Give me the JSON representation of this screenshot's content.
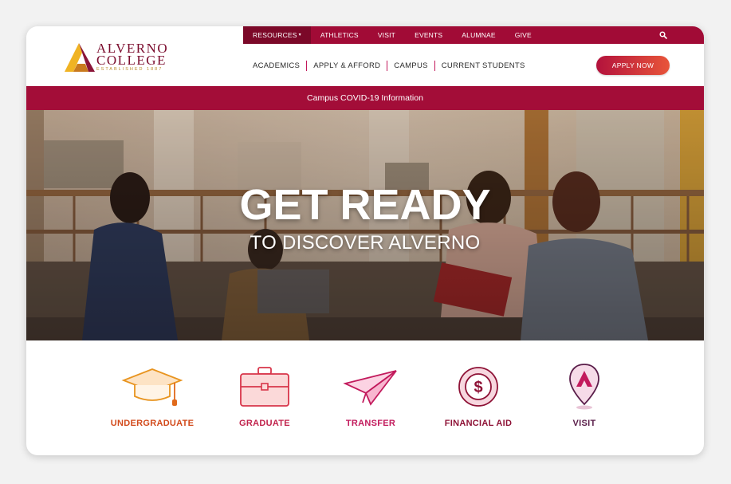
{
  "colors": {
    "brand": "#a10b36",
    "brand_dark": "#7b0828",
    "gold": "#e8a11f",
    "undergraduate": "#d24a1b",
    "graduate": "#c1234c",
    "transfer": "#c21a5c",
    "financial_aid": "#8e1236",
    "visit": "#5a1e4a"
  },
  "logo": {
    "line1": "ALVERNO",
    "line2": "COLLEGE",
    "established": "ESTABLISHED 1887",
    "icon": "alverno-a-logo-icon"
  },
  "utility_nav": {
    "items": [
      {
        "label": "RESOURCES",
        "has_dropdown": true,
        "active": true
      },
      {
        "label": "ATHLETICS"
      },
      {
        "label": "VISIT"
      },
      {
        "label": "EVENTS"
      },
      {
        "label": "ALUMNAE"
      },
      {
        "label": "GIVE"
      }
    ],
    "caret": "▾",
    "search_icon": "search-icon"
  },
  "main_nav": {
    "items": [
      {
        "label": "ACADEMICS"
      },
      {
        "label": "APPLY & AFFORD"
      },
      {
        "label": "CAMPUS"
      },
      {
        "label": "CURRENT STUDENTS"
      }
    ]
  },
  "apply_button": "APPLY NOW",
  "covid_banner": "Campus COVID-19 Information",
  "hero": {
    "title": "GET READY",
    "subtitle": "TO DISCOVER ALVERNO"
  },
  "quick_links": [
    {
      "label": "UNDERGRADUATE",
      "icon": "graduation-cap-icon"
    },
    {
      "label": "GRADUATE",
      "icon": "briefcase-icon"
    },
    {
      "label": "TRANSFER",
      "icon": "paper-plane-icon"
    },
    {
      "label": "FINANCIAL AID",
      "icon": "dollar-coin-icon"
    },
    {
      "label": "VISIT",
      "icon": "map-pin-icon"
    }
  ]
}
